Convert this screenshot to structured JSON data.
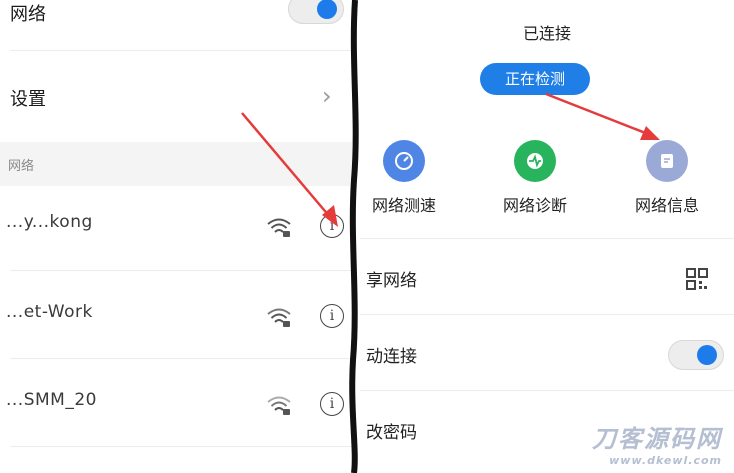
{
  "left": {
    "wlan_label": "网络",
    "settings_label": "设置",
    "section_label": "网络",
    "networks": [
      {
        "name": "...y...kong"
      },
      {
        "name": "...et-Work"
      },
      {
        "name": "...SMM_20"
      }
    ]
  },
  "right": {
    "status": "已连接",
    "detect_button": "正在检测",
    "tools": [
      {
        "label": "网络测速",
        "color": "#4f86e6"
      },
      {
        "label": "网络诊断",
        "color": "#28b35d"
      },
      {
        "label": "网络信息",
        "color": "#9aa9d6"
      }
    ],
    "rows": [
      {
        "label": "享网络"
      },
      {
        "label": "动连接"
      },
      {
        "label": "改密码"
      }
    ]
  },
  "watermark": {
    "main": "刀客源码网",
    "url": "www.dkewl.com"
  },
  "accent_color": "#1f7fe7",
  "arrow_color": "#e53b3b"
}
